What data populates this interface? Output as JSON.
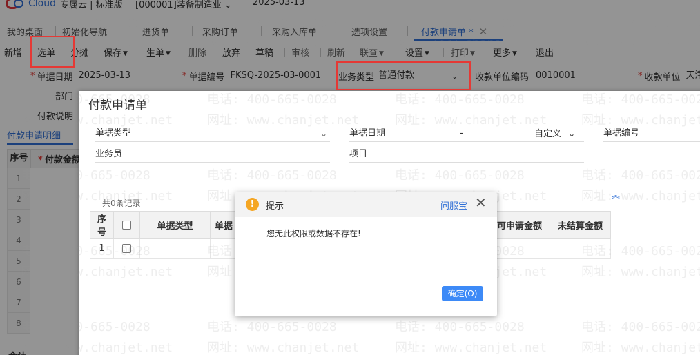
{
  "header": {
    "logo_text": "Cloud",
    "edition": "专属云 | 标准版",
    "company": "[000001]装备制造业 ⌄",
    "date": "2025-03-13"
  },
  "tabs": [
    {
      "label": "我的桌面"
    },
    {
      "label": "初始化导航"
    },
    {
      "label": "进货单"
    },
    {
      "label": "采购订单"
    },
    {
      "label": "采购入库单"
    },
    {
      "label": "选项设置"
    },
    {
      "label": "付款申请单 *",
      "active": true
    }
  ],
  "toolbar": {
    "new": "新增",
    "select": "选单",
    "split": "分摊",
    "save": "保存",
    "generate": "生单",
    "delete": "删除",
    "abandon": "放弃",
    "draft": "草稿",
    "audit": "审核",
    "refresh": "刷新",
    "link": "联查",
    "settings": "设置",
    "print": "打印",
    "more": "更多",
    "exit": "退出"
  },
  "form": {
    "doc_date_label": "单据日期",
    "doc_date_value": "2025-03-13",
    "doc_no_label": "单据编号",
    "doc_no_value": "FKSQ-2025-03-0001",
    "biz_type_label": "业务类型",
    "biz_type_value": "普通付款",
    "payee_code_label": "收款单位编码",
    "payee_code_value": "0010001",
    "payee_label": "收款单位",
    "payee_value": "天津",
    "dept_label": "部门",
    "remark_label": "付款说明",
    "detail_tab": "付款申请明细",
    "grid_no": "序号",
    "grid_amount": "付款金额",
    "row_numbers": [
      "1",
      "2",
      "3",
      "4",
      "5",
      "6",
      "7",
      "8"
    ],
    "total_label": "合计"
  },
  "select_dialog": {
    "title": "付款申请单",
    "doc_type_label": "单据类型",
    "doc_date_label": "单据日期",
    "date_sep": "-",
    "date_mode": "自定义",
    "doc_no_label": "单据编号",
    "salesman_label": "业务员",
    "project_label": "项目",
    "record_count": "共0条记录",
    "columns": [
      "序号",
      "",
      "单据类型",
      "单据",
      "可申请金额",
      "未结算金额"
    ],
    "rows": [
      [
        "1"
      ]
    ]
  },
  "alert": {
    "title": "提示",
    "help_link": "问服宝",
    "message": "您无此权限或数据不存在!",
    "ok_label": "确定(O)"
  },
  "watermark": {
    "phone": "电话: 400-665-0028",
    "site": "网址: www.chanjet.net"
  },
  "colors": {
    "accent": "#2f6fd6",
    "highlight_box": "#e53935",
    "ok_button": "#3d8af7",
    "warning": "#f5a623"
  }
}
